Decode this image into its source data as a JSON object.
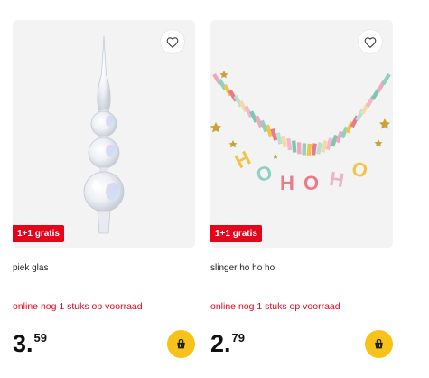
{
  "products": [
    {
      "title": "piek glas",
      "promo": "1+1 gratis",
      "stock": "online nog 1 stuks op voorraad",
      "price_int": "3",
      "price_sep": ".",
      "price_dec": "59"
    },
    {
      "title": "slinger ho ho ho",
      "promo": "1+1 gratis",
      "stock": "online nog 1 stuks op voorraad",
      "price_int": "2",
      "price_sep": ".",
      "price_dec": "79",
      "image_text": [
        "H",
        "O",
        "H",
        "O",
        "H",
        "O"
      ]
    }
  ],
  "icons": {
    "favorite": "heart-outline-icon",
    "cart": "shopping-basket-icon"
  },
  "colors": {
    "promo": "#e3051b",
    "stock_text": "#e3051b",
    "cart_button": "#f7c21a",
    "image_background": "#f3f3f3"
  }
}
